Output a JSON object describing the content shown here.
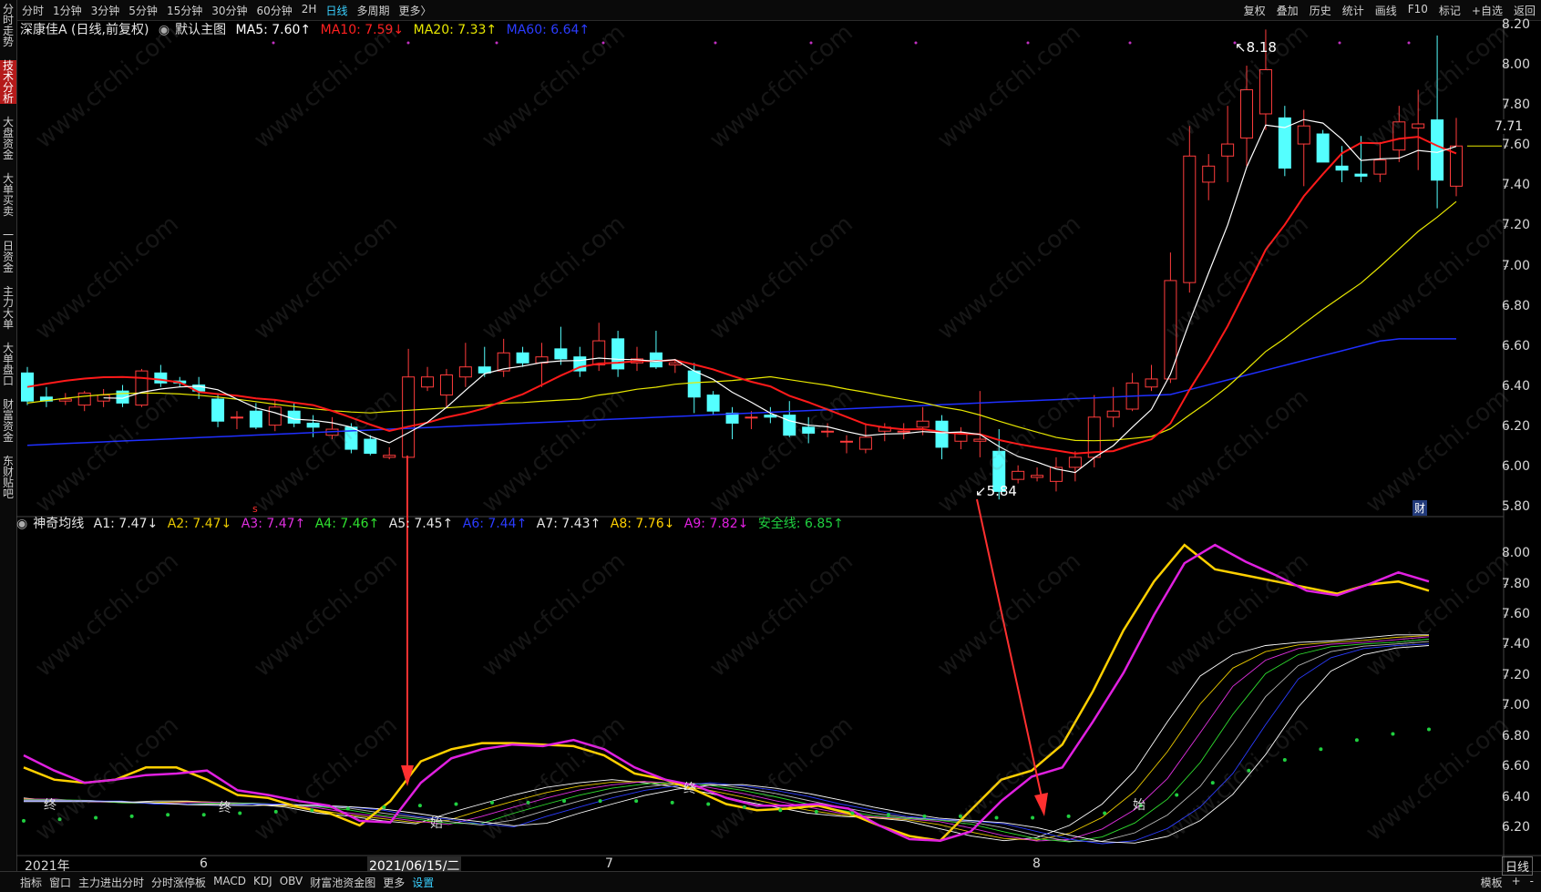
{
  "toolbar": {
    "tabs": [
      "分时",
      "1分钟",
      "3分钟",
      "5分钟",
      "15分钟",
      "30分钟",
      "60分钟",
      "2H",
      "日线",
      "多周期",
      "更多〉"
    ],
    "active_tab": "日线",
    "right": [
      "复权",
      "叠加",
      "历史",
      "统计",
      "画线",
      "F10",
      "标记",
      "+自选",
      "返回"
    ]
  },
  "sidebar": [
    "分时走势",
    "技术分析",
    "大盘资金",
    "大单买卖",
    "一日资金",
    "主力大单",
    "大单盘口",
    "财富资金",
    "东财贴吧"
  ],
  "main_legend": {
    "stock": "深康佳A (日线,前复权)",
    "template": "默认主图",
    "ma5": "MA5: 7.60↑",
    "ma10": "MA10: 7.59↓",
    "ma20": "MA20: 7.33↑",
    "ma60": "MA60: 6.64↑"
  },
  "sub_legend": {
    "name": "神奇均线",
    "a1": "A1: 7.47↓",
    "a2": "A2: 7.47↓",
    "a3": "A3: 7.47↑",
    "a4": "A4: 7.46↑",
    "a5": "A5: 7.45↑",
    "a6": "A6: 7.44↑",
    "a7": "A7: 7.43↑",
    "a8": "A8: 7.76↓",
    "a9": "A9: 7.82↓",
    "safe": "安全线: 6.85↑"
  },
  "annotations": {
    "high": "8.18",
    "low": "5.84",
    "current_price": "7.71",
    "cai": "财",
    "zhong1": "终",
    "zhong2": "终",
    "zhong3": "终",
    "shi1": "始",
    "shi2": "始"
  },
  "xaxis": {
    "year": "2021年",
    "m6": "6",
    "cursor_date": "2021/06/15/二",
    "m7": "7",
    "m8": "8"
  },
  "bottombar": {
    "items": [
      "指标",
      "窗口",
      "主力进出分时",
      "分时涨停板",
      "MACD",
      "KDJ",
      "OBV",
      "财富池资金图",
      "更多",
      "设置"
    ],
    "right": [
      "模板",
      "+",
      "-"
    ]
  },
  "timeframe_label": "日线",
  "colors": {
    "up": "#ff3c3c",
    "down": "#54ffff",
    "ma5": "#ffffff",
    "ma10": "#ff1a1a",
    "ma20": "#e8e800",
    "ma60": "#1f2fff",
    "a8": "#ffd000",
    "a9": "#e020e0",
    "safe": "#20d040"
  },
  "chart_data": [
    {
      "type": "candlestick",
      "title": "深康佳A (日线,前复权)",
      "ylim": [
        5.8,
        8.2
      ],
      "yticks": [
        8.2,
        8.0,
        7.8,
        7.6,
        7.4,
        7.2,
        7.0,
        6.8,
        6.6,
        6.4,
        6.2,
        6.0,
        5.8
      ],
      "xlabels": [
        "2021年",
        "6",
        "2021/06/15/二",
        "7",
        "8"
      ],
      "candles": [
        {
          "o": 6.47,
          "h": 6.5,
          "l": 6.31,
          "c": 6.33
        },
        {
          "o": 6.35,
          "h": 6.4,
          "l": 6.3,
          "c": 6.33
        },
        {
          "o": 6.33,
          "h": 6.37,
          "l": 6.31,
          "c": 6.34
        },
        {
          "o": 6.31,
          "h": 6.38,
          "l": 6.28,
          "c": 6.37
        },
        {
          "o": 6.33,
          "h": 6.39,
          "l": 6.3,
          "c": 6.36
        },
        {
          "o": 6.38,
          "h": 6.41,
          "l": 6.3,
          "c": 6.32
        },
        {
          "o": 6.31,
          "h": 6.49,
          "l": 6.3,
          "c": 6.48
        },
        {
          "o": 6.47,
          "h": 6.51,
          "l": 6.4,
          "c": 6.42
        },
        {
          "o": 6.43,
          "h": 6.45,
          "l": 6.4,
          "c": 6.42
        },
        {
          "o": 6.41,
          "h": 6.45,
          "l": 6.34,
          "c": 6.38
        },
        {
          "o": 6.34,
          "h": 6.37,
          "l": 6.2,
          "c": 6.23
        },
        {
          "o": 6.25,
          "h": 6.28,
          "l": 6.19,
          "c": 6.25
        },
        {
          "o": 6.28,
          "h": 6.32,
          "l": 6.19,
          "c": 6.2
        },
        {
          "o": 6.21,
          "h": 6.34,
          "l": 6.18,
          "c": 6.3
        },
        {
          "o": 6.28,
          "h": 6.32,
          "l": 6.2,
          "c": 6.22
        },
        {
          "o": 6.22,
          "h": 6.26,
          "l": 6.15,
          "c": 6.2
        },
        {
          "o": 6.16,
          "h": 6.25,
          "l": 6.14,
          "c": 6.19
        },
        {
          "o": 6.2,
          "h": 6.22,
          "l": 6.07,
          "c": 6.09
        },
        {
          "o": 6.14,
          "h": 6.16,
          "l": 6.06,
          "c": 6.07
        },
        {
          "o": 6.05,
          "h": 6.1,
          "l": 6.04,
          "c": 6.06
        },
        {
          "o": 6.05,
          "h": 6.59,
          "l": 6.05,
          "c": 6.45
        },
        {
          "o": 6.4,
          "h": 6.5,
          "l": 6.38,
          "c": 6.45
        },
        {
          "o": 6.36,
          "h": 6.49,
          "l": 6.3,
          "c": 6.46
        },
        {
          "o": 6.45,
          "h": 6.62,
          "l": 6.4,
          "c": 6.5
        },
        {
          "o": 6.5,
          "h": 6.6,
          "l": 6.45,
          "c": 6.47
        },
        {
          "o": 6.48,
          "h": 6.64,
          "l": 6.45,
          "c": 6.57
        },
        {
          "o": 6.57,
          "h": 6.6,
          "l": 6.5,
          "c": 6.52
        },
        {
          "o": 6.52,
          "h": 6.62,
          "l": 6.4,
          "c": 6.55
        },
        {
          "o": 6.59,
          "h": 6.7,
          "l": 6.51,
          "c": 6.54
        },
        {
          "o": 6.55,
          "h": 6.6,
          "l": 6.45,
          "c": 6.48
        },
        {
          "o": 6.51,
          "h": 6.72,
          "l": 6.48,
          "c": 6.63
        },
        {
          "o": 6.64,
          "h": 6.68,
          "l": 6.45,
          "c": 6.49
        },
        {
          "o": 6.52,
          "h": 6.6,
          "l": 6.48,
          "c": 6.54
        },
        {
          "o": 6.57,
          "h": 6.68,
          "l": 6.49,
          "c": 6.5
        },
        {
          "o": 6.51,
          "h": 6.54,
          "l": 6.47,
          "c": 6.52
        },
        {
          "o": 6.48,
          "h": 6.52,
          "l": 6.27,
          "c": 6.35
        },
        {
          "o": 6.36,
          "h": 6.38,
          "l": 6.26,
          "c": 6.28
        },
        {
          "o": 6.27,
          "h": 6.3,
          "l": 6.14,
          "c": 6.22
        },
        {
          "o": 6.25,
          "h": 6.28,
          "l": 6.19,
          "c": 6.25
        },
        {
          "o": 6.26,
          "h": 6.3,
          "l": 6.22,
          "c": 6.25
        },
        {
          "o": 6.26,
          "h": 6.33,
          "l": 6.15,
          "c": 6.16
        },
        {
          "o": 6.2,
          "h": 6.25,
          "l": 6.12,
          "c": 6.17
        },
        {
          "o": 6.18,
          "h": 6.22,
          "l": 6.15,
          "c": 6.18
        },
        {
          "o": 6.13,
          "h": 6.16,
          "l": 6.07,
          "c": 6.13
        },
        {
          "o": 6.09,
          "h": 6.22,
          "l": 6.07,
          "c": 6.15
        },
        {
          "o": 6.18,
          "h": 6.22,
          "l": 6.13,
          "c": 6.2
        },
        {
          "o": 6.18,
          "h": 6.22,
          "l": 6.14,
          "c": 6.18
        },
        {
          "o": 6.2,
          "h": 6.3,
          "l": 6.16,
          "c": 6.23
        },
        {
          "o": 6.23,
          "h": 6.26,
          "l": 6.04,
          "c": 6.1
        },
        {
          "o": 6.13,
          "h": 6.2,
          "l": 6.09,
          "c": 6.17
        },
        {
          "o": 6.13,
          "h": 6.38,
          "l": 6.05,
          "c": 6.14
        },
        {
          "o": 6.08,
          "h": 6.19,
          "l": 5.84,
          "c": 5.88
        },
        {
          "o": 5.94,
          "h": 6.01,
          "l": 5.92,
          "c": 5.98
        },
        {
          "o": 5.95,
          "h": 6.0,
          "l": 5.93,
          "c": 5.96
        },
        {
          "o": 5.93,
          "h": 6.05,
          "l": 5.88,
          "c": 6.0
        },
        {
          "o": 6.0,
          "h": 6.08,
          "l": 5.93,
          "c": 6.05
        },
        {
          "o": 6.05,
          "h": 6.36,
          "l": 6.0,
          "c": 6.25
        },
        {
          "o": 6.25,
          "h": 6.4,
          "l": 6.2,
          "c": 6.28
        },
        {
          "o": 6.29,
          "h": 6.47,
          "l": 6.28,
          "c": 6.42
        },
        {
          "o": 6.4,
          "h": 6.51,
          "l": 6.38,
          "c": 6.44
        },
        {
          "o": 6.44,
          "h": 7.07,
          "l": 6.42,
          "c": 6.93
        },
        {
          "o": 6.92,
          "h": 7.7,
          "l": 6.87,
          "c": 7.55
        },
        {
          "o": 7.42,
          "h": 7.56,
          "l": 7.33,
          "c": 7.5
        },
        {
          "o": 7.55,
          "h": 7.8,
          "l": 7.42,
          "c": 7.61
        },
        {
          "o": 7.64,
          "h": 8.0,
          "l": 7.5,
          "c": 7.88
        },
        {
          "o": 7.76,
          "h": 8.18,
          "l": 7.68,
          "c": 7.98
        },
        {
          "o": 7.74,
          "h": 7.8,
          "l": 7.45,
          "c": 7.49
        },
        {
          "o": 7.61,
          "h": 7.78,
          "l": 7.4,
          "c": 7.7
        },
        {
          "o": 7.66,
          "h": 7.68,
          "l": 7.52,
          "c": 7.52
        },
        {
          "o": 7.5,
          "h": 7.6,
          "l": 7.42,
          "c": 7.48
        },
        {
          "o": 7.46,
          "h": 7.65,
          "l": 7.42,
          "c": 7.45
        },
        {
          "o": 7.46,
          "h": 7.62,
          "l": 7.42,
          "c": 7.53
        },
        {
          "o": 7.58,
          "h": 7.8,
          "l": 7.52,
          "c": 7.72
        },
        {
          "o": 7.69,
          "h": 7.88,
          "l": 7.48,
          "c": 7.71
        },
        {
          "o": 7.73,
          "h": 8.15,
          "l": 7.29,
          "c": 7.43
        },
        {
          "o": 7.4,
          "h": 7.74,
          "l": 7.35,
          "c": 7.6
        }
      ]
    },
    {
      "type": "line",
      "title": "神奇均线",
      "ylim": [
        6.1,
        8.15
      ],
      "yticks": [
        8.0,
        7.8,
        7.6,
        7.4,
        7.2,
        7.0,
        6.8,
        6.6,
        6.4,
        6.2
      ],
      "series": [
        {
          "name": "A8",
          "values": [
            6.6,
            6.52,
            6.5,
            6.52,
            6.6,
            6.6,
            6.52,
            6.42,
            6.4,
            6.34,
            6.3,
            6.22,
            6.38,
            6.64,
            6.72,
            6.76,
            6.76,
            6.75,
            6.74,
            6.68,
            6.56,
            6.52,
            6.45,
            6.36,
            6.32,
            6.33,
            6.35,
            6.3,
            6.22,
            6.15,
            6.12,
            6.32,
            6.52,
            6.58,
            6.75,
            7.1,
            7.5,
            7.82,
            8.06,
            7.9,
            7.86,
            7.82,
            7.78,
            7.74,
            7.8,
            7.82,
            7.76
          ]
        },
        {
          "name": "A9",
          "values": [
            6.68,
            6.58,
            6.5,
            6.52,
            6.55,
            6.56,
            6.58,
            6.45,
            6.42,
            6.38,
            6.35,
            6.25,
            6.24,
            6.5,
            6.66,
            6.72,
            6.75,
            6.74,
            6.78,
            6.72,
            6.6,
            6.52,
            6.48,
            6.4,
            6.35,
            6.35,
            6.36,
            6.33,
            6.22,
            6.13,
            6.12,
            6.18,
            6.38,
            6.54,
            6.6,
            6.9,
            7.22,
            7.6,
            7.94,
            8.06,
            7.95,
            7.86,
            7.76,
            7.73,
            7.8,
            7.88,
            7.82
          ]
        },
        {
          "name": "A1",
          "values": [
            6.4,
            6.38,
            6.38,
            6.37,
            6.38,
            6.38,
            6.37,
            6.36,
            6.34,
            6.3,
            6.28,
            6.25,
            6.23,
            6.3,
            6.36,
            6.42,
            6.47,
            6.5,
            6.52,
            6.5,
            6.47,
            6.43,
            6.38,
            6.34,
            6.3,
            6.28,
            6.27,
            6.25,
            6.2,
            6.15,
            6.12,
            6.14,
            6.22,
            6.36,
            6.58,
            6.9,
            7.2,
            7.34,
            7.4,
            7.42,
            7.43,
            7.45,
            7.47,
            7.47
          ]
        },
        {
          "name": "安全线",
          "values": [
            6.25,
            6.26,
            6.27,
            6.28,
            6.29,
            6.29,
            6.3,
            6.31,
            6.32,
            6.33,
            6.34,
            6.35,
            6.36,
            6.37,
            6.37,
            6.38,
            6.38,
            6.38,
            6.37,
            6.36,
            6.34,
            6.32,
            6.31,
            6.3,
            6.29,
            6.28,
            6.28,
            6.27,
            6.27,
            6.28,
            6.3,
            6.35,
            6.42,
            6.5,
            6.58,
            6.65,
            6.72,
            6.78,
            6.82,
            6.85
          ]
        }
      ]
    }
  ]
}
